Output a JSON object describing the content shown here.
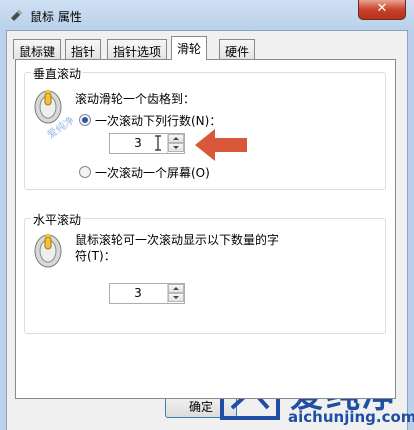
{
  "window": {
    "title": "鼠标 属性",
    "close_glyph": "✕"
  },
  "tabs": [
    {
      "label": "鼠标键",
      "active": false
    },
    {
      "label": "指针",
      "active": false
    },
    {
      "label": "指针选项",
      "active": false
    },
    {
      "label": "滑轮",
      "active": true
    },
    {
      "label": "硬件",
      "active": false
    }
  ],
  "vertical": {
    "title": "垂直滚动",
    "description": "滚动滑轮一个齿格到：",
    "option_lines": "一次滚动下列行数(N)：",
    "option_lines_selected": true,
    "lines_value": "3",
    "option_screen": "一次滚动一个屏幕(O)",
    "option_screen_selected": false
  },
  "horizontal": {
    "title": "水平滚动",
    "description_line1": "鼠标滚轮可一次滚动显示以下数量的字",
    "description_line2": "符(T)：",
    "chars_value": "3"
  },
  "buttons": {
    "ok": "确定"
  },
  "watermark": {
    "small": "爱纯净",
    "brand": "爱纯净",
    "url": "aichunjing.com"
  },
  "colors": {
    "arrow": "#d9583a",
    "accent": "#2b57a8",
    "brand": "#1f4ea3"
  }
}
